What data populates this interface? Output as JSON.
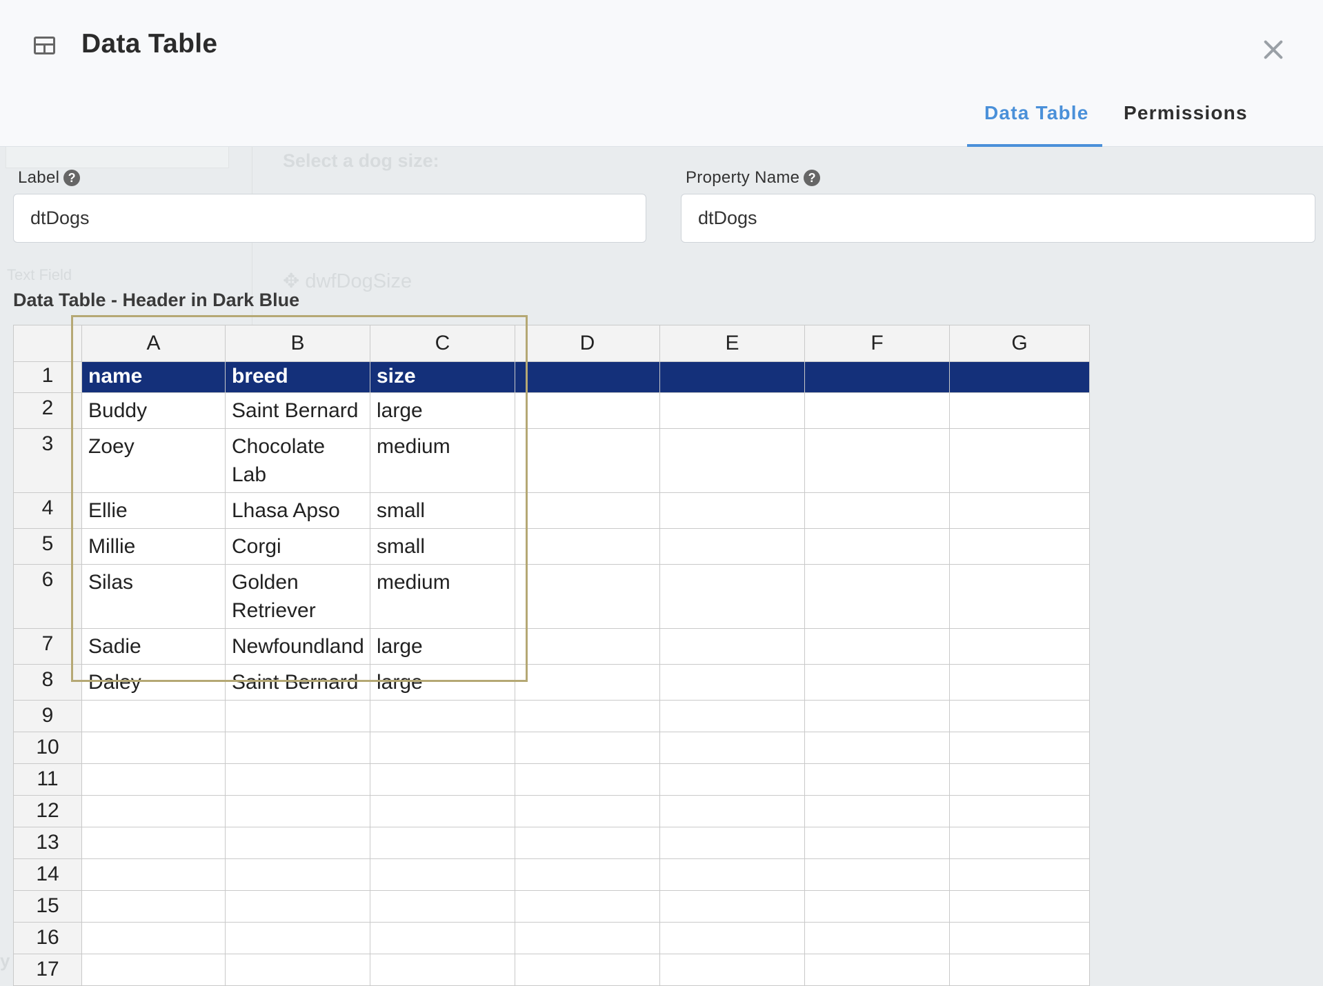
{
  "dialog": {
    "title": "Data Table",
    "tabs": [
      {
        "label": "Data Table",
        "active": true
      },
      {
        "label": "Permissions",
        "active": false
      }
    ]
  },
  "form": {
    "label_field": {
      "label": "Label",
      "value": "dtDogs"
    },
    "property_field": {
      "label": "Property Name",
      "value": "dtDogs"
    },
    "help_glyph": "?"
  },
  "table_section": {
    "title": "Data Table - Header in Dark Blue",
    "header_color": "#14307a",
    "columns": [
      "A",
      "B",
      "C",
      "D",
      "E",
      "F",
      "G"
    ],
    "row_numbers": [
      "1",
      "2",
      "3",
      "4",
      "5",
      "6",
      "7",
      "8",
      "9",
      "10",
      "11",
      "12",
      "13",
      "14",
      "15",
      "16",
      "17"
    ],
    "rows": [
      [
        "name",
        "breed",
        "size",
        "",
        "",
        "",
        ""
      ],
      [
        "Buddy",
        "Saint Bernard",
        "large",
        "",
        "",
        "",
        ""
      ],
      [
        "Zoey",
        "Chocolate Lab",
        "medium",
        "",
        "",
        "",
        ""
      ],
      [
        "Ellie",
        "Lhasa Apso",
        "small",
        "",
        "",
        "",
        ""
      ],
      [
        "Millie",
        "Corgi",
        "small",
        "",
        "",
        "",
        ""
      ],
      [
        "Silas",
        "Golden Retriever",
        "medium",
        "",
        "",
        "",
        ""
      ],
      [
        "Sadie",
        "Newfoundland",
        "large",
        "",
        "",
        "",
        ""
      ],
      [
        "Daley",
        "Saint Bernard",
        "large",
        "",
        "",
        "",
        ""
      ],
      [
        "",
        "",
        "",
        "",
        "",
        "",
        ""
      ],
      [
        "",
        "",
        "",
        "",
        "",
        "",
        ""
      ],
      [
        "",
        "",
        "",
        "",
        "",
        "",
        ""
      ],
      [
        "",
        "",
        "",
        "",
        "",
        "",
        ""
      ],
      [
        "",
        "",
        "",
        "",
        "",
        "",
        ""
      ],
      [
        "",
        "",
        "",
        "",
        "",
        "",
        ""
      ],
      [
        "",
        "",
        "",
        "",
        "",
        "",
        ""
      ],
      [
        "",
        "",
        "",
        "",
        "",
        "",
        ""
      ],
      [
        "",
        "",
        "",
        "",
        "",
        "",
        ""
      ]
    ]
  },
  "background": {
    "prompt": "Select a dog size:",
    "field_type": "Text Field",
    "component": "dwfDogSize",
    "fields_heading": "y Fields"
  }
}
